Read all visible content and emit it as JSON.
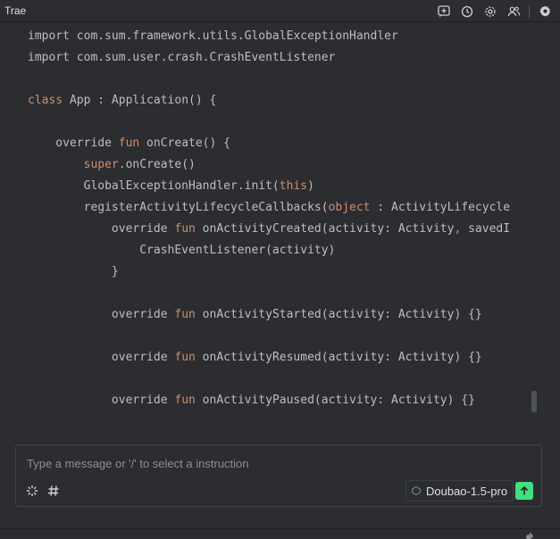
{
  "window": {
    "title": "Trae"
  },
  "toolbar": {
    "icons": [
      "new-chat-icon",
      "history-icon",
      "settings-icon",
      "team-icon",
      "gear-icon"
    ]
  },
  "code": {
    "language": "kotlin",
    "lines": [
      [
        {
          "t": "import com.sum.framework.utils.GlobalExceptionHandler"
        }
      ],
      [
        {
          "t": "import com.sum.user.crash.CrashEventListener"
        }
      ],
      [
        {
          "t": ""
        }
      ],
      [
        {
          "t": "class",
          "k": 1
        },
        {
          "t": " App : Application() {"
        }
      ],
      [
        {
          "t": ""
        }
      ],
      [
        {
          "t": "    override "
        },
        {
          "t": "fun",
          "k": 1
        },
        {
          "t": " onCreate() {"
        }
      ],
      [
        {
          "t": "        "
        },
        {
          "t": "super",
          "k": 1
        },
        {
          "t": ".onCreate()"
        }
      ],
      [
        {
          "t": "        GlobalExceptionHandler.init("
        },
        {
          "t": "this",
          "k": 1
        },
        {
          "t": ")"
        }
      ],
      [
        {
          "t": "        registerActivityLifecycleCallbacks("
        },
        {
          "t": "object",
          "k": 1
        },
        {
          "t": " : ActivityLifecycle"
        }
      ],
      [
        {
          "t": "            override "
        },
        {
          "t": "fun",
          "k": 1
        },
        {
          "t": " onActivityCreated(activity: Activity"
        },
        {
          "t": ",",
          "k": 1
        },
        {
          "t": " savedI"
        }
      ],
      [
        {
          "t": "                CrashEventListener(activity)"
        }
      ],
      [
        {
          "t": "            }"
        }
      ],
      [
        {
          "t": ""
        }
      ],
      [
        {
          "t": "            override "
        },
        {
          "t": "fun",
          "k": 1
        },
        {
          "t": " onActivityStarted(activity: Activity) {}"
        }
      ],
      [
        {
          "t": ""
        }
      ],
      [
        {
          "t": "            override "
        },
        {
          "t": "fun",
          "k": 1
        },
        {
          "t": " onActivityResumed(activity: Activity) {}"
        }
      ],
      [
        {
          "t": ""
        }
      ],
      [
        {
          "t": "            override "
        },
        {
          "t": "fun",
          "k": 1
        },
        {
          "t": " onActivityPaused(activity: Activity) {}"
        }
      ]
    ]
  },
  "chat": {
    "placeholder": "Type a message or '/' to select a instruction",
    "value": "",
    "tools": [
      "sparkle-icon",
      "hash-icon"
    ],
    "model": "Doubao-1.5-pro"
  },
  "colors": {
    "accent": "#3ee07f",
    "keyword": "#cf8e6d",
    "text": "#bcbec4",
    "background": "#2b2d30"
  }
}
